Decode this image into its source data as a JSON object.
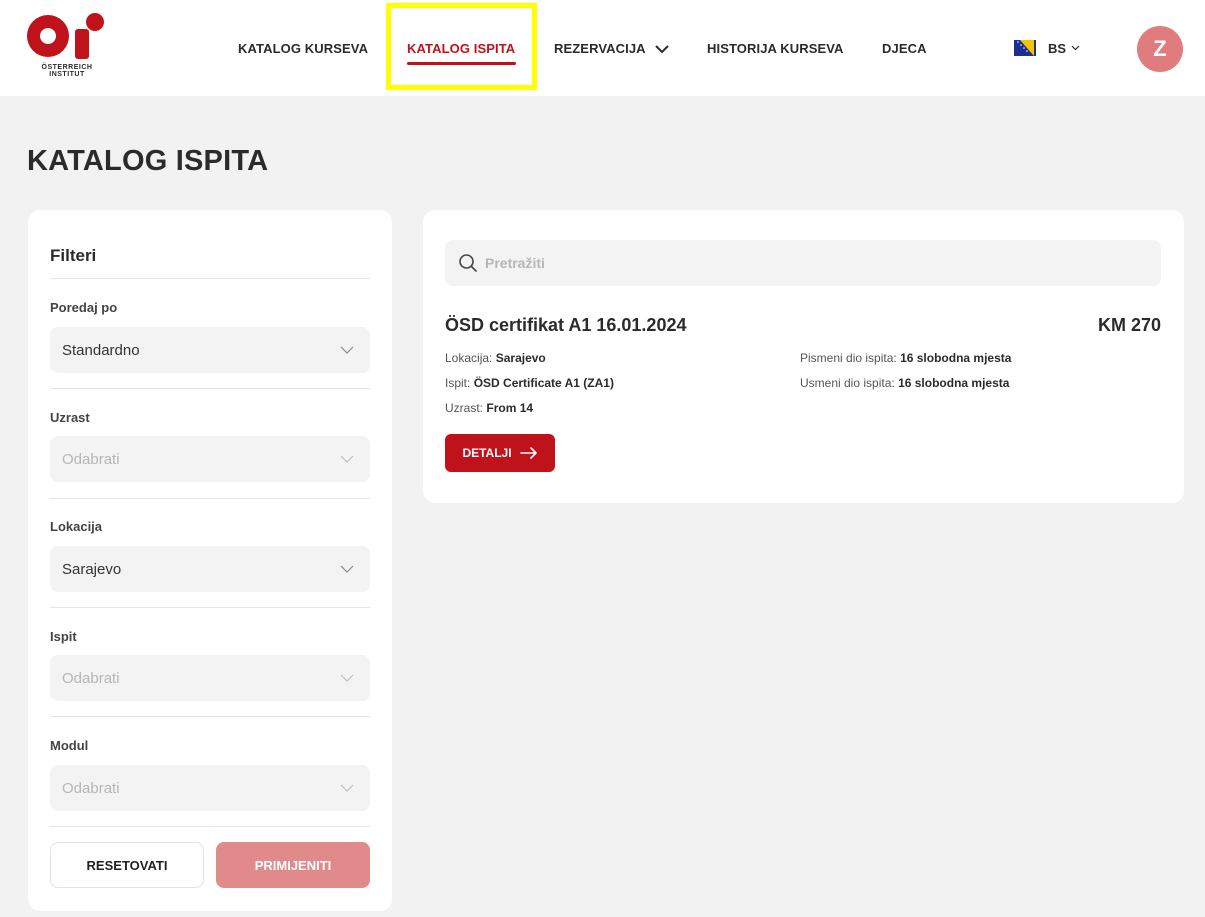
{
  "brand": {
    "logo_text_line1": "ÖSTERREICH",
    "logo_text_line2": "INSTITUT",
    "accent_color": "#c0121b"
  },
  "nav": {
    "items": [
      {
        "label": "KATALOG KURSEVA",
        "active": false
      },
      {
        "label": "KATALOG ISPITA",
        "active": true
      },
      {
        "label": "REZERVACIJA",
        "active": false,
        "has_dropdown": true
      },
      {
        "label": "HISTORIJA KURSEVA",
        "active": false
      },
      {
        "label": "DJECA",
        "active": false
      }
    ],
    "language": {
      "code": "BS",
      "flag": "bosnia-flag-icon"
    },
    "avatar_initial": "Z"
  },
  "page": {
    "title": "KATALOG ISPITA"
  },
  "filters": {
    "heading": "Filteri",
    "groups": [
      {
        "label": "Poredaj po",
        "value": "Standardno",
        "placeholder": false
      },
      {
        "label": "Uzrast",
        "value": "Odabrati",
        "placeholder": true
      },
      {
        "label": "Lokacija",
        "value": "Sarajevo",
        "placeholder": false
      },
      {
        "label": "Ispit",
        "value": "Odabrati",
        "placeholder": true
      },
      {
        "label": "Modul",
        "value": "Odabrati",
        "placeholder": true
      }
    ],
    "reset_label": "RESETOVATI",
    "apply_label": "PRIMIJENITI"
  },
  "search": {
    "placeholder": "Pretražiti"
  },
  "exam": {
    "title": "ÖSD certifikat A1 16.01.2024",
    "price": "KM 270",
    "location_label": "Lokacija:",
    "location_value": "Sarajevo",
    "exam_label": "Ispit:",
    "exam_value": "ÖSD Certificate A1 (ZA1)",
    "age_label": "Uzrast:",
    "age_value": "From 14",
    "written_label": "Pismeni dio ispita:",
    "written_value": "16 slobodna mjesta",
    "oral_label": "Usmeni dio ispita:",
    "oral_value": "16 slobodna mjesta",
    "details_label": "DETALJI"
  }
}
